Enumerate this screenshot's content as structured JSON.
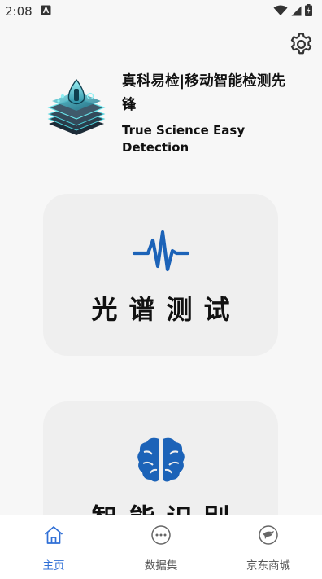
{
  "status_bar": {
    "time": "2:08",
    "icons": [
      "notification-a-icon",
      "wifi-icon",
      "signal-icon",
      "battery-icon"
    ]
  },
  "header": {
    "title_cn": "真科易检|移动智能检测先锋",
    "title_en": "True Science Easy Detection",
    "settings_icon": "gear-icon"
  },
  "cards": [
    {
      "label": "光谱测试",
      "icon": "pulse-wave-icon",
      "icon_color": "#1c63b8"
    },
    {
      "label": "智能识别",
      "icon": "brain-icon",
      "icon_color": "#1c63b8"
    }
  ],
  "bottom_nav": {
    "items": [
      {
        "label": "主页",
        "icon": "home-icon",
        "active": true
      },
      {
        "label": "数据集",
        "icon": "more-dots-icon",
        "active": false
      },
      {
        "label": "京东商城",
        "icon": "jd-store-icon",
        "active": false
      }
    ]
  },
  "colors": {
    "accent": "#2f6fd6",
    "card_icon": "#1c63b8",
    "card_bg": "#efefef",
    "page_bg": "#f7f7f7"
  }
}
